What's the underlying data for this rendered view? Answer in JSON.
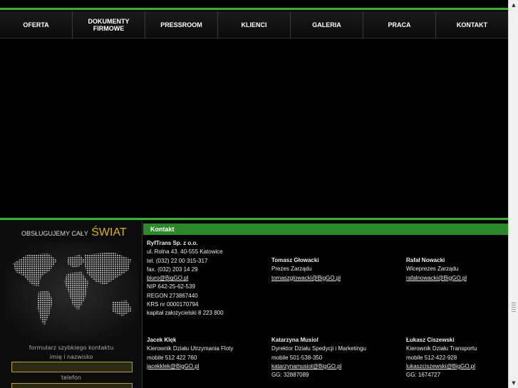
{
  "nav": {
    "items": [
      {
        "label": "OFERTA"
      },
      {
        "label": "DOKUMENTY",
        "label2": "FIRMOWE"
      },
      {
        "label": "PRESSROOM"
      },
      {
        "label": "KLIENCI"
      },
      {
        "label": "GALERIA"
      },
      {
        "label": "PRACA"
      },
      {
        "label": "KONTAKT"
      }
    ]
  },
  "left": {
    "world_small": "OBSŁUGUJEMY CAŁY",
    "world_big": "ŚWIAT",
    "form_title": "formularz szybkiego kontaktu",
    "name_label": "imię i nazwisko",
    "phone_label": "telefon",
    "name_value": "",
    "phone_value": ""
  },
  "kontakt": {
    "title": "Kontakt",
    "company": {
      "name": "RyfTrans Sp. z o.o.",
      "address": "ul. Rolna 43. 40-555 Katowice",
      "tel": "tel. (032) 22 00 315-317",
      "fax": "fax. (032) 203 14 29",
      "email": "biuro@BigGO.pl",
      "nip": "NIP 642-25-62-539",
      "regon": "REGON 273867440",
      "krs": "KRS nr 0000170794",
      "capital": "kapitał założycielski 8 223 800"
    },
    "people": [
      {
        "name": "Tomasz Głowacki",
        "role": "Prezes Zarządu",
        "line3": "tomaszglowacki@BigGO.pl",
        "line4": ""
      },
      {
        "name": "Rafał Nowacki",
        "role": "Wiceprezes Zarządu",
        "line3": "rafalnowacki@BigGO.pl",
        "line4": ""
      },
      {
        "name": "Jacek Klęk",
        "role": "Kierownik Działu Utrzymania Floty",
        "line3": "mobile 512 422 760",
        "line4": "jacekklek@BigGO.pl"
      },
      {
        "name": "Katarzyna Musiol",
        "role": "Dyrektor Działu Spedycji i Marketingu",
        "line3": "mobile 501-538-350",
        "line4": "katarzynamusiol@BigGO.pl",
        "line5": "GG: 32887089"
      },
      {
        "name": "Łukasz Ciszewski",
        "role": "Kierownik Działu Transportu",
        "line3": "mobile 512-422-928",
        "line4": "lukaszciszewski@BigGO.pl",
        "line5": "GG: 1674727"
      }
    ]
  },
  "colors": {
    "accent_green": "#2fb52a",
    "gold": "#d9b300"
  }
}
